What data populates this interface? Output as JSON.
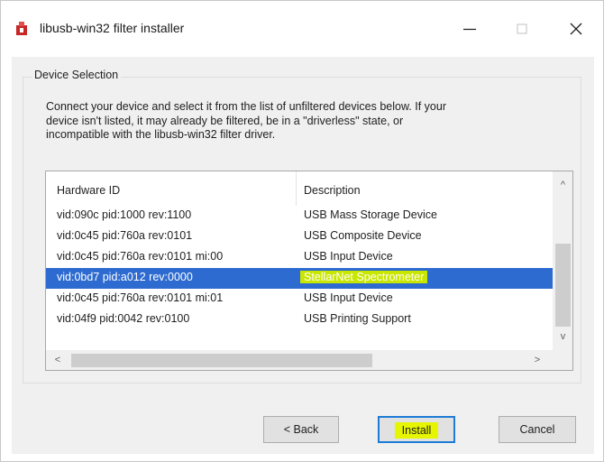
{
  "window": {
    "title": "libusb-win32 filter installer",
    "controls": {
      "minimize": "—",
      "maximize": "□",
      "close": "✕"
    }
  },
  "group": {
    "title": "Device Selection",
    "instructions": "Connect your device and select it from the list of unfiltered devices below. If your\ndevice isn't listed, it may already be filtered, be in a \"driverless\" state, or\nincompatible with the libusb-win32 filter driver."
  },
  "device_list": {
    "columns": [
      "Hardware ID",
      "Description"
    ],
    "rows": [
      {
        "hardware_id": "vid:090c pid:1000 rev:1100",
        "description": "USB Mass Storage Device"
      },
      {
        "hardware_id": "vid:0c45 pid:760a rev:0101",
        "description": "USB Composite Device"
      },
      {
        "hardware_id": "vid:0c45 pid:760a rev:0101 mi:00",
        "description": "USB Input Device"
      },
      {
        "hardware_id": "vid:0bd7 pid:a012 rev:0000",
        "description": "StellarNet Spectrometer",
        "selected": true
      },
      {
        "hardware_id": "vid:0c45 pid:760a rev:0101 mi:01",
        "description": "USB Input Device"
      },
      {
        "hardware_id": "vid:04f9 pid:0042 rev:0100",
        "description": "USB Printing Support"
      }
    ],
    "scroll_arrows": {
      "up": "^",
      "down": "v",
      "left": "<",
      "right": ">"
    }
  },
  "buttons": {
    "back": "< Back",
    "install": "Install",
    "cancel": "Cancel"
  },
  "colors": {
    "selection": "#2e6bd1",
    "highlight": "#c9e600",
    "install_highlight": "#e6f500",
    "app_icon": "#c62828"
  }
}
